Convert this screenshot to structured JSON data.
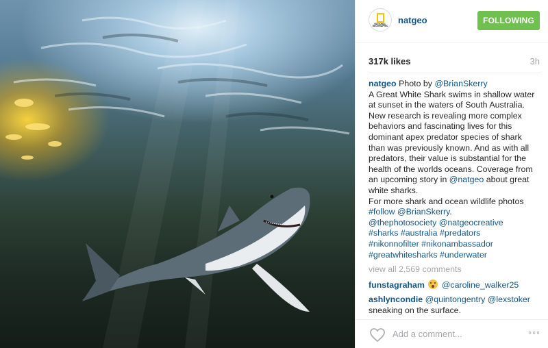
{
  "header": {
    "avatar_text": "NATIONAL GEOGRAPHIC",
    "username": "natgeo",
    "follow_label": "FOLLOWING"
  },
  "stats": {
    "likes": "317k likes",
    "time": "3h"
  },
  "caption": {
    "user": "natgeo",
    "line1_text": "Photo by",
    "photographer": "@BrianSkerry",
    "body": "A Great White Shark swims in shallow water at sunset in the waters of South Australia. New research is revealing more complex behaviors and fascinating lives for this dominant apex predator species of shark than was previously known. And as with all predators, their value is substantial for the health of the worlds oceans. Coverage from an upcoming story in",
    "mention_natgeo": "@natgeo",
    "body2": "about great white sharks.",
    "body3": "For more shark and ocean wildlife photos",
    "follow_tag": "#follow",
    "follow_user": "@BrianSkerry",
    "period": ".",
    "mention_photosociety": "@thephotosociety",
    "mention_natgeocreative": "@natgeocreative",
    "tag_sharks": "#sharks",
    "tag_australia": "#australia",
    "tag_predators": "#predators",
    "tag_nikonnofilter": "#nikonnofilter",
    "tag_nikonambassador": "#nikonambassador",
    "tag_greatwhitesharks": "#greatwhitesharks",
    "tag_underwater": "#underwater"
  },
  "comments": {
    "view_all": "view all 2,569 comments",
    "items": [
      {
        "user": "funstagraham",
        "mention": "@caroline_walker25",
        "text": ""
      },
      {
        "user": "ashlyncondie",
        "mention1": "@quintongentry",
        "mention2": "@lexstoker",
        "text": "sneaking on the surface."
      }
    ]
  },
  "footer": {
    "placeholder": "Add a comment...",
    "more": "◦◦◦"
  },
  "colors": {
    "link": "#125688",
    "follow_green": "#70c050",
    "muted": "#a5a7aa"
  },
  "icons": {
    "like": "heart-icon",
    "options": "more-options-icon",
    "emoji": "screaming-face-emoji"
  }
}
